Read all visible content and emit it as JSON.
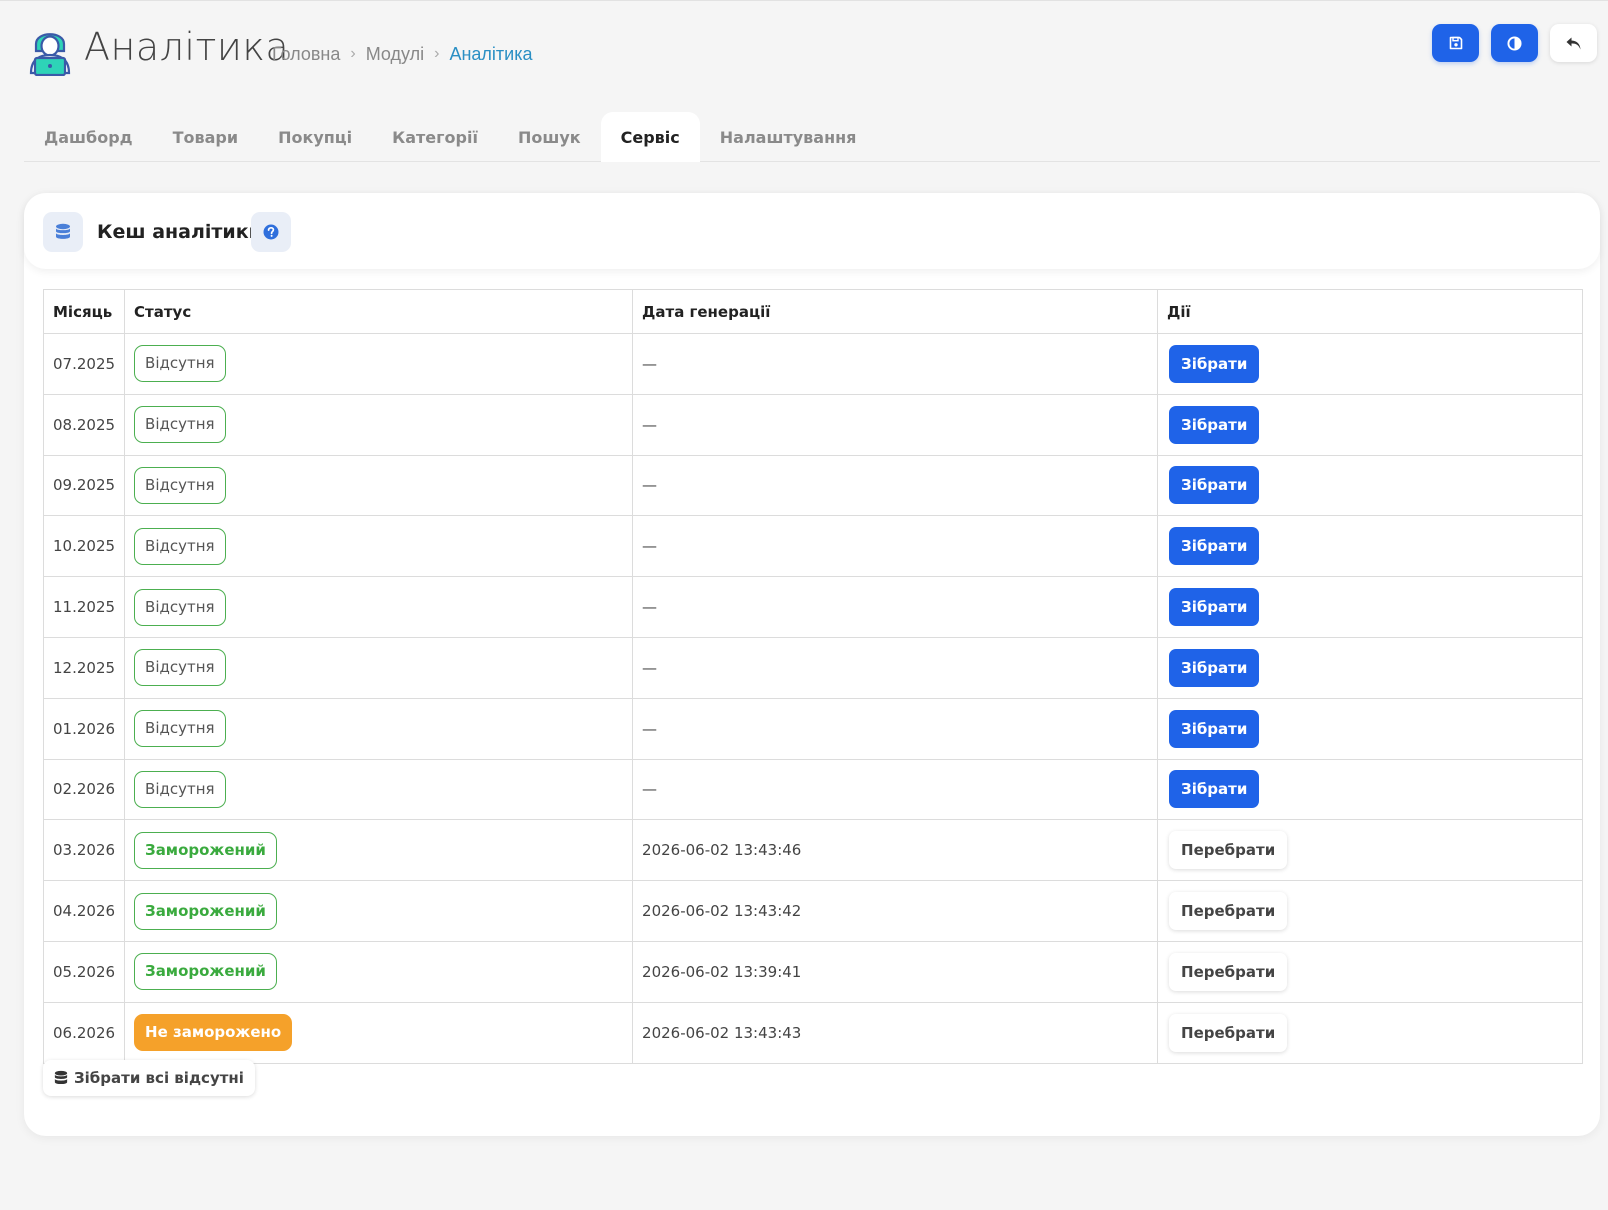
{
  "header": {
    "title": "Аналітика",
    "breadcrumb": [
      {
        "label": "Головна",
        "active": false
      },
      {
        "label": "Модулі",
        "active": false
      },
      {
        "label": "Аналітика",
        "active": true
      }
    ],
    "separator": "›",
    "buttons": [
      {
        "name": "save-button",
        "icon": "floppy-disk-icon"
      },
      {
        "name": "contrast-button",
        "icon": "contrast-icon"
      },
      {
        "name": "back-button",
        "icon": "reply-arrow-icon"
      }
    ]
  },
  "tabs": [
    {
      "label": "Дашборд",
      "active": false
    },
    {
      "label": "Товари",
      "active": false
    },
    {
      "label": "Покупці",
      "active": false
    },
    {
      "label": "Категорії",
      "active": false
    },
    {
      "label": "Пошук",
      "active": false
    },
    {
      "label": "Сервіс",
      "active": true
    },
    {
      "label": "Налаштування",
      "active": false
    }
  ],
  "card": {
    "title": "Кеш аналітики",
    "icon": "database-icon",
    "help_icon": "question-circle-icon"
  },
  "table": {
    "columns": [
      "Місяць",
      "Статус",
      "Дата генерації",
      "Дії"
    ],
    "rows": [
      {
        "month": "07.2025",
        "status": "Відсутня",
        "status_type": "absent",
        "date": "—",
        "action": "Зібрати",
        "action_type": "collect"
      },
      {
        "month": "08.2025",
        "status": "Відсутня",
        "status_type": "absent",
        "date": "—",
        "action": "Зібрати",
        "action_type": "collect"
      },
      {
        "month": "09.2025",
        "status": "Відсутня",
        "status_type": "absent",
        "date": "—",
        "action": "Зібрати",
        "action_type": "collect"
      },
      {
        "month": "10.2025",
        "status": "Відсутня",
        "status_type": "absent",
        "date": "—",
        "action": "Зібрати",
        "action_type": "collect"
      },
      {
        "month": "11.2025",
        "status": "Відсутня",
        "status_type": "absent",
        "date": "—",
        "action": "Зібрати",
        "action_type": "collect"
      },
      {
        "month": "12.2025",
        "status": "Відсутня",
        "status_type": "absent",
        "date": "—",
        "action": "Зібрати",
        "action_type": "collect"
      },
      {
        "month": "01.2026",
        "status": "Відсутня",
        "status_type": "absent",
        "date": "—",
        "action": "Зібрати",
        "action_type": "collect"
      },
      {
        "month": "02.2026",
        "status": "Відсутня",
        "status_type": "absent",
        "date": "—",
        "action": "Зібрати",
        "action_type": "collect"
      },
      {
        "month": "03.2026",
        "status": "Заморожений",
        "status_type": "frozen",
        "date": "2026-06-02 13:43:46",
        "action": "Перебрати",
        "action_type": "recollect"
      },
      {
        "month": "04.2026",
        "status": "Заморожений",
        "status_type": "frozen",
        "date": "2026-06-02 13:43:42",
        "action": "Перебрати",
        "action_type": "recollect"
      },
      {
        "month": "05.2026",
        "status": "Заморожений",
        "status_type": "frozen",
        "date": "2026-06-02 13:39:41",
        "action": "Перебрати",
        "action_type": "recollect"
      },
      {
        "month": "06.2026",
        "status": "Не заморожено",
        "status_type": "unfrozen",
        "date": "2026-06-02 13:43:43",
        "action": "Перебрати",
        "action_type": "recollect"
      }
    ]
  },
  "footer_button": {
    "label": "Зібрати всі відсутні",
    "icon": "database-icon"
  },
  "colors": {
    "primary": "#1f63e8",
    "success_border": "#4caf50",
    "success_text": "#3aaa3e",
    "warning": "#f5a12a",
    "breadcrumb_active": "#2a8fc4",
    "logo_accent": "#2ed3b7"
  }
}
